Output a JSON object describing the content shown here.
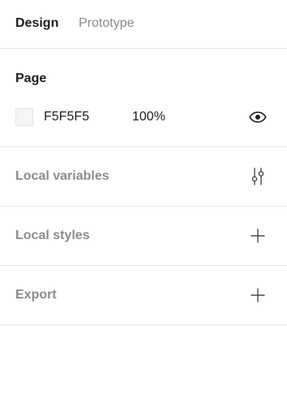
{
  "tabs": [
    {
      "label": "Design",
      "active": true
    },
    {
      "label": "Prototype",
      "active": false
    }
  ],
  "page": {
    "heading": "Page",
    "background_color": "#F5F5F5",
    "hex_value": "F5F5F5",
    "opacity_value": "100%",
    "visibility_icon": "eye-icon"
  },
  "sections": {
    "local_variables": {
      "label": "Local variables",
      "icon": "sliders-icon"
    },
    "local_styles": {
      "label": "Local styles",
      "icon": "plus-icon"
    },
    "export": {
      "label": "Export",
      "icon": "plus-icon"
    }
  },
  "colors": {
    "text_primary": "#1e1e1e",
    "text_secondary": "#8c8c8c",
    "divider": "#e6e6e6"
  }
}
